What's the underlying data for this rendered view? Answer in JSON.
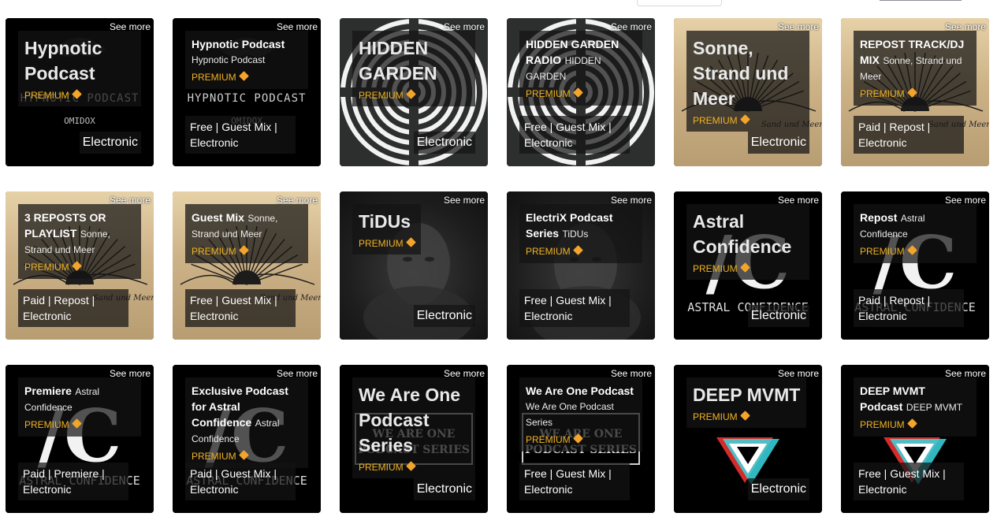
{
  "see_more_label": "See more",
  "premium_label": "PREMIUM",
  "premium_icon": "diamond-icon",
  "premium_color": "#f0b323",
  "cards": [
    {
      "style": "big",
      "title": "Hypnotic Podcast",
      "subtitle": "",
      "premium": true,
      "tags": "",
      "genre": "Electronic",
      "bg": "black",
      "art": "hypnotic"
    },
    {
      "style": "small",
      "title": "Hypnotic Podcast",
      "subtitle": "Hypnotic Podcast",
      "premium": true,
      "tags": "Free | Guest Mix | Electronic",
      "genre": "",
      "bg": "black",
      "art": "hypnotic"
    },
    {
      "style": "big",
      "title": "HIDDEN GARDEN",
      "subtitle": "",
      "premium": true,
      "tags": "",
      "genre": "Electronic",
      "bg": "laby",
      "art": "labyrinth"
    },
    {
      "style": "small",
      "title": "HIDDEN GARDEN RADIO",
      "subtitle": "HIDDEN GARDEN",
      "premium": true,
      "tags": "Free | Guest Mix | Electronic",
      "genre": "",
      "bg": "laby",
      "art": "labyrinth"
    },
    {
      "style": "big",
      "title": "Sonne, Strand und Meer",
      "subtitle": "",
      "premium": true,
      "tags": "",
      "genre": "Electronic",
      "bg": "sand",
      "art": "sun"
    },
    {
      "style": "small",
      "title": "REPOST TRACK/DJ MIX",
      "subtitle": "Sonne, Strand und Meer",
      "premium": true,
      "tags": "Paid | Repost | Electronic",
      "genre": "",
      "bg": "sand",
      "art": "sun"
    },
    {
      "style": "small",
      "title": "3 REPOSTS OR PLAYLIST",
      "subtitle": "Sonne, Strand und Meer",
      "premium": true,
      "tags": "Paid | Repost | Electronic",
      "genre": "",
      "bg": "sand",
      "art": "sun"
    },
    {
      "style": "small",
      "title": "Guest Mix",
      "subtitle": "Sonne, Strand und Meer",
      "premium": true,
      "tags": "Free | Guest Mix | Electronic",
      "genre": "",
      "bg": "sand",
      "art": "sun"
    },
    {
      "style": "big",
      "title": "TiDUs",
      "subtitle": "",
      "premium": true,
      "tags": "",
      "genre": "Electronic",
      "bg": "gray",
      "art": "face"
    },
    {
      "style": "small",
      "title": "ElectriX Podcast Series",
      "subtitle": "TiDUs",
      "premium": true,
      "tags": "Free | Guest Mix | Electronic",
      "genre": "",
      "bg": "gray",
      "art": "face"
    },
    {
      "style": "big",
      "title": "Astral Confidence",
      "subtitle": "",
      "premium": true,
      "tags": "",
      "genre": "Electronic",
      "bg": "black",
      "art": "astral"
    },
    {
      "style": "small",
      "title": "Repost",
      "subtitle": "Astral Confidence",
      "premium": true,
      "tags": "Paid | Repost | Electronic",
      "genre": "",
      "bg": "black",
      "art": "astral"
    },
    {
      "style": "small",
      "title": "Premiere",
      "subtitle": "Astral Confidence",
      "premium": true,
      "tags": "Paid | Premiere | Electronic",
      "genre": "",
      "bg": "black",
      "art": "astral"
    },
    {
      "style": "small",
      "title": "Exclusive Podcast for Astral Confidence",
      "subtitle": "Astral Confidence",
      "premium": true,
      "tags": "Paid | Guest Mix | Electronic",
      "genre": "",
      "bg": "black",
      "art": "astral"
    },
    {
      "style": "big",
      "title": "We Are One Podcast Series",
      "subtitle": "",
      "premium": true,
      "tags": "",
      "genre": "Electronic",
      "bg": "black",
      "art": "weareone"
    },
    {
      "style": "small",
      "title": "We Are One Podcast",
      "subtitle": "We Are One Podcast Series",
      "premium": true,
      "tags": "Free | Guest Mix | Electronic",
      "genre": "",
      "bg": "black",
      "art": "weareone"
    },
    {
      "style": "big",
      "title": "DEEP MVMT",
      "subtitle": "",
      "premium": true,
      "tags": "",
      "genre": "Electronic",
      "bg": "black",
      "art": "deep"
    },
    {
      "style": "small",
      "title": "DEEP MVMT Podcast",
      "subtitle": "DEEP MVMT",
      "premium": true,
      "tags": "Free | Guest Mix | Electronic",
      "genre": "",
      "bg": "black",
      "art": "deep"
    }
  ],
  "art_text": {
    "hypnotic": "HYPNOTIC PODCAST",
    "hypnotic_sub": "OMIDOX",
    "astral": "ASTRAL CONFIDENCE",
    "weareone_1": "WE ARE ONE",
    "weareone_2": "PODCAST SERIES",
    "sun": "Sand und Meer"
  }
}
